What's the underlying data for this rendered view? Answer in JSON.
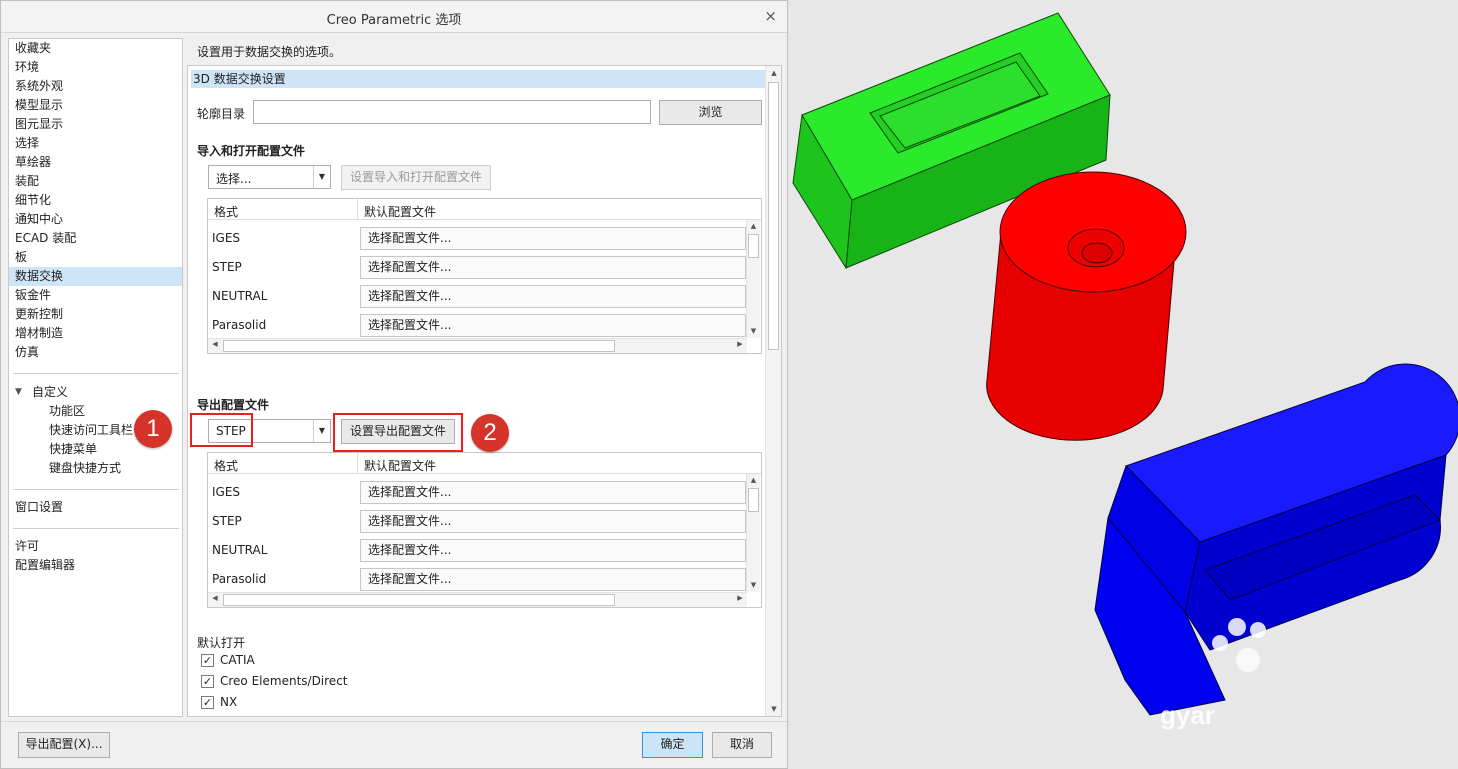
{
  "window": {
    "title": "Creo Parametric 选项",
    "close_glyph": "×"
  },
  "nav": {
    "items": [
      "收藏夹",
      "环境",
      "系统外观",
      "模型显示",
      "图元显示",
      "选择",
      "草绘器",
      "装配",
      "细节化",
      "通知中心",
      "ECAD 装配",
      "板",
      "数据交换",
      "钣金件",
      "更新控制",
      "增材制造",
      "仿真"
    ],
    "selected": "数据交换",
    "customize": {
      "label": "自定义",
      "children": [
        "功能区",
        "快速访问工具栏",
        "快捷菜单",
        "键盘快捷方式"
      ]
    },
    "window_settings": "窗口设置",
    "group3": [
      "许可",
      "配置编辑器"
    ]
  },
  "panel": {
    "description": "设置用于数据交换的选项。",
    "section_title": "3D 数据交换设置",
    "profile_dir_label": "轮廓目录",
    "profile_dir_value": "",
    "browse_label": "浏览",
    "import": {
      "heading": "导入和打开配置文件",
      "combo_value": "选择...",
      "set_button": "设置导入和打开配置文件"
    },
    "export": {
      "heading": "导出配置文件",
      "combo_value": "STEP",
      "set_button": "设置导出配置文件"
    },
    "table_headers": [
      "格式",
      "默认配置文件"
    ],
    "formats": [
      "IGES",
      "STEP",
      "NEUTRAL",
      "Parasolid"
    ],
    "file_placeholder": "选择配置文件...",
    "default_open": {
      "heading": "默认打开",
      "items": [
        {
          "label": "CATIA",
          "checked": true
        },
        {
          "label": "Creo Elements/Direct",
          "checked": true
        },
        {
          "label": "NX",
          "checked": true
        }
      ]
    }
  },
  "annotations": {
    "badge1": "1",
    "badge2": "2"
  },
  "footer": {
    "export_config": "导出配置(X)...",
    "ok": "确定",
    "cancel": "取消"
  },
  "viewport": {
    "watermark": "gyar"
  },
  "colors": {
    "green": "#1ed41e",
    "red": "#ff0000",
    "blue": "#0000ff",
    "highlight": "#e8211a",
    "selected": "#cde6f7"
  }
}
